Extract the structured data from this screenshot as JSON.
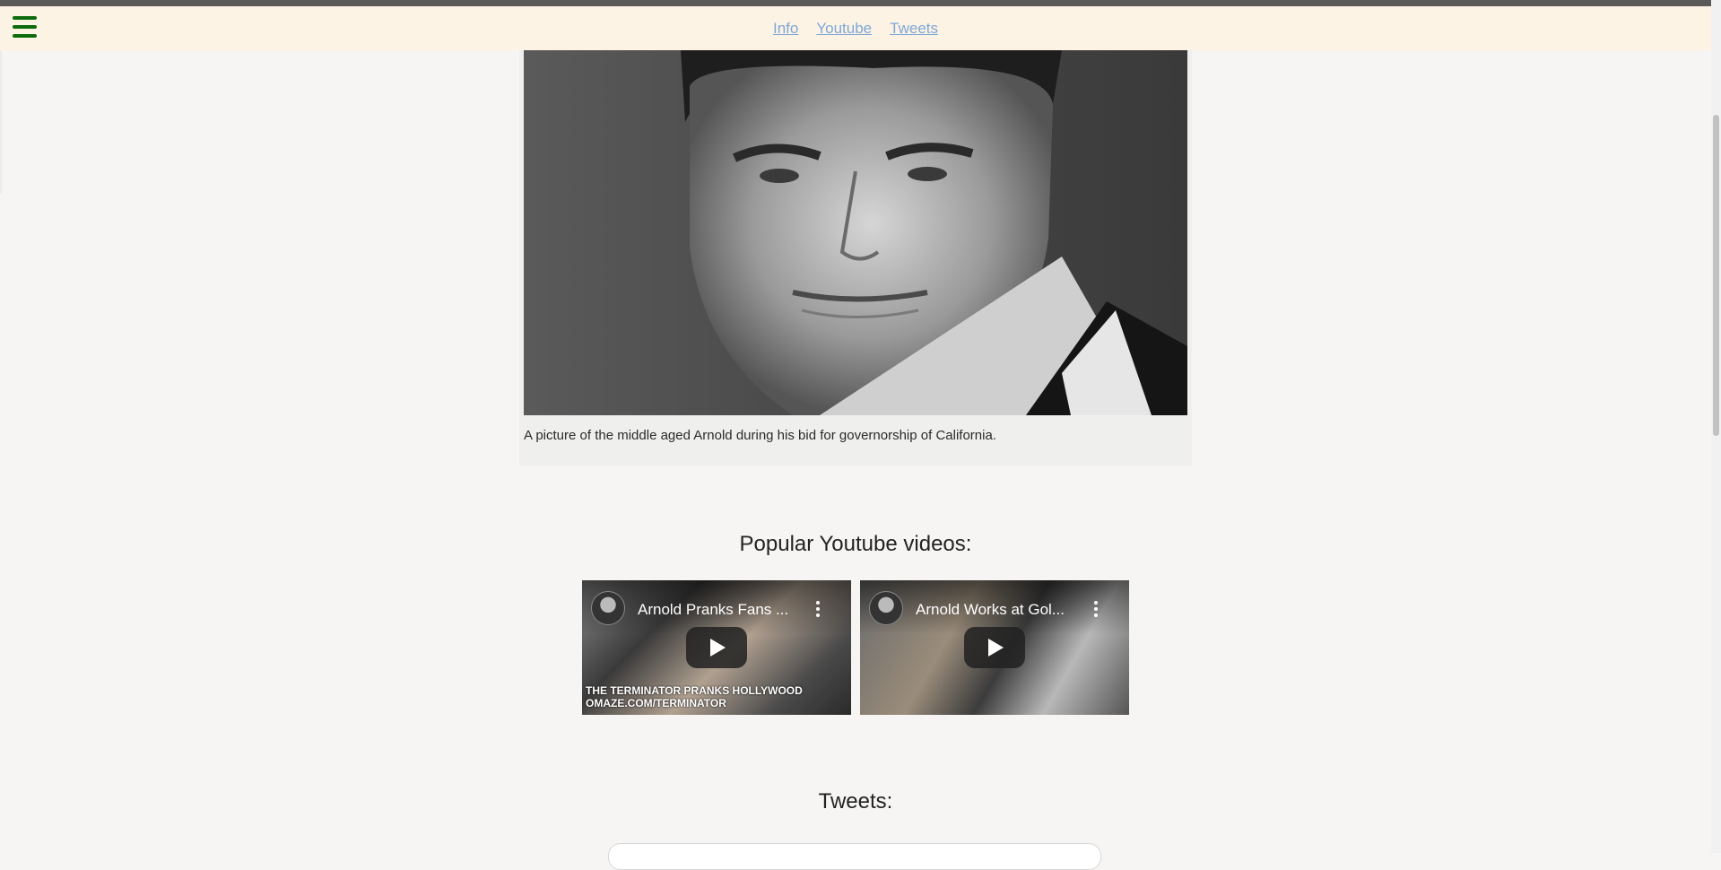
{
  "nav": {
    "menu_icon": "hamburger-menu-icon",
    "links": [
      "Info",
      "Youtube",
      "Tweets"
    ]
  },
  "figure": {
    "caption": "A picture of the middle aged Arnold during his bid for governorship of California."
  },
  "youtube": {
    "heading": "Popular Youtube videos:",
    "videos": [
      {
        "title": "Arnold Pranks Fans ...",
        "banner_line1": "THE TERMINATOR PRANKS HOLLYWOOD",
        "banner_line2": "OMAZE.COM/TERMINATOR"
      },
      {
        "title": "Arnold Works at Gol..."
      }
    ]
  },
  "tweets": {
    "heading": "Tweets:"
  },
  "colors": {
    "navbar_bg": "#fdf3e4",
    "link": "#7da7d9",
    "menu_icon": "#0d6b0d",
    "page_bg": "#f6f5f3"
  }
}
